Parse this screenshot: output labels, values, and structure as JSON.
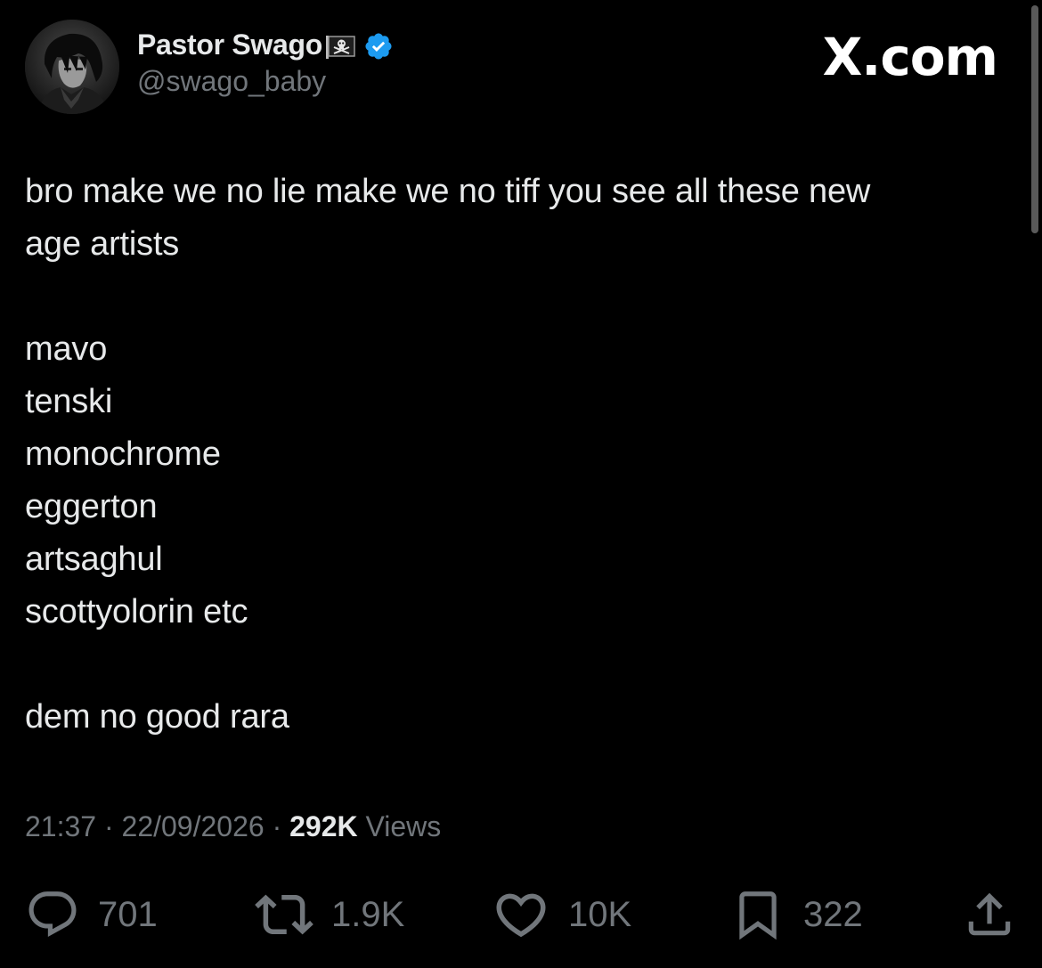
{
  "author": {
    "display_name": "Pastor Swago",
    "name_emoji": "pirate-flag",
    "verified_icon": "verified-badge-icon",
    "handle": "@swago_baby"
  },
  "brand": {
    "label": "X.com"
  },
  "tweet": {
    "lines": [
      "bro make we no lie make we no tiff you see all these new",
      "age artists",
      "",
      "mavo",
      "tenski",
      "monochrome",
      "eggerton",
      "artsaghul",
      "scottyolorin etc",
      "",
      "dem no good rara"
    ]
  },
  "meta": {
    "time": "21:37",
    "separator": "·",
    "date": "22/09/2026",
    "views_count": "292K",
    "views_label": "Views"
  },
  "actions": {
    "replies": "701",
    "reposts": "1.9K",
    "likes": "10K",
    "bookmarks": "322"
  },
  "colors": {
    "background": "#000000",
    "text": "#e7e9ea",
    "secondary": "#71767b",
    "verified": "#1d9bf0"
  },
  "icons": [
    "reply-icon",
    "repost-icon",
    "like-icon",
    "bookmark-icon",
    "share-icon"
  ]
}
